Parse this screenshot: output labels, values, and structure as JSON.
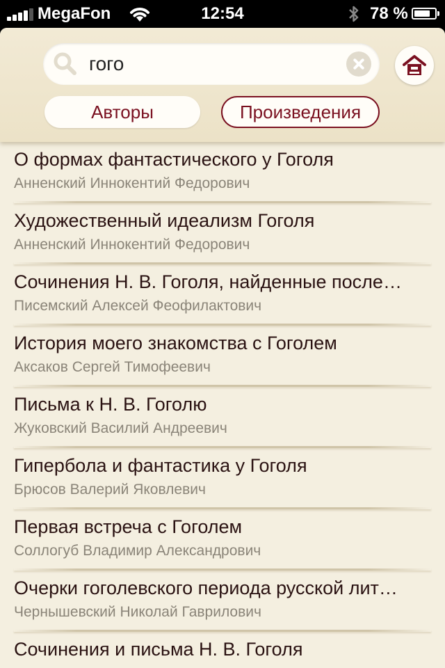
{
  "status_bar": {
    "carrier": "MegaFon",
    "time": "12:54",
    "battery_percent": "78 %",
    "battery_level": 0.78,
    "signal_bars": 4
  },
  "header": {
    "search": {
      "value": "гого",
      "placeholder": ""
    },
    "tabs": {
      "authors_label": "Авторы",
      "works_label": "Произведения",
      "selected": "works"
    }
  },
  "colors": {
    "accent": "#7a1020",
    "background": "#f4efe0",
    "header": "#ece2c7"
  },
  "results": [
    {
      "title": "О формах фантастического у Гоголя",
      "author": "Анненский Иннокентий Федорович"
    },
    {
      "title": "Художественный идеализм Гоголя",
      "author": "Анненский Иннокентий Федорович"
    },
    {
      "title": "Сочинения Н. В. Гоголя, найденные после…",
      "author": "Писемский Алексей Феофилактович"
    },
    {
      "title": "История моего знакомства с Гоголем",
      "author": "Аксаков Сергей Тимофеевич"
    },
    {
      "title": "Письма к Н. В. Гоголю",
      "author": "Жуковский Василий Андреевич"
    },
    {
      "title": "Гипербола и фантастика у Гоголя",
      "author": "Брюсов Валерий Яковлевич"
    },
    {
      "title": "Первая встреча с Гоголем",
      "author": "Соллогуб Владимир Александрович"
    },
    {
      "title": "Очерки гоголевского периода русской лит…",
      "author": "Чернышевский Николай Гаврилович"
    },
    {
      "title": "Сочинения и письма Н. В. Гоголя",
      "author": ""
    }
  ]
}
